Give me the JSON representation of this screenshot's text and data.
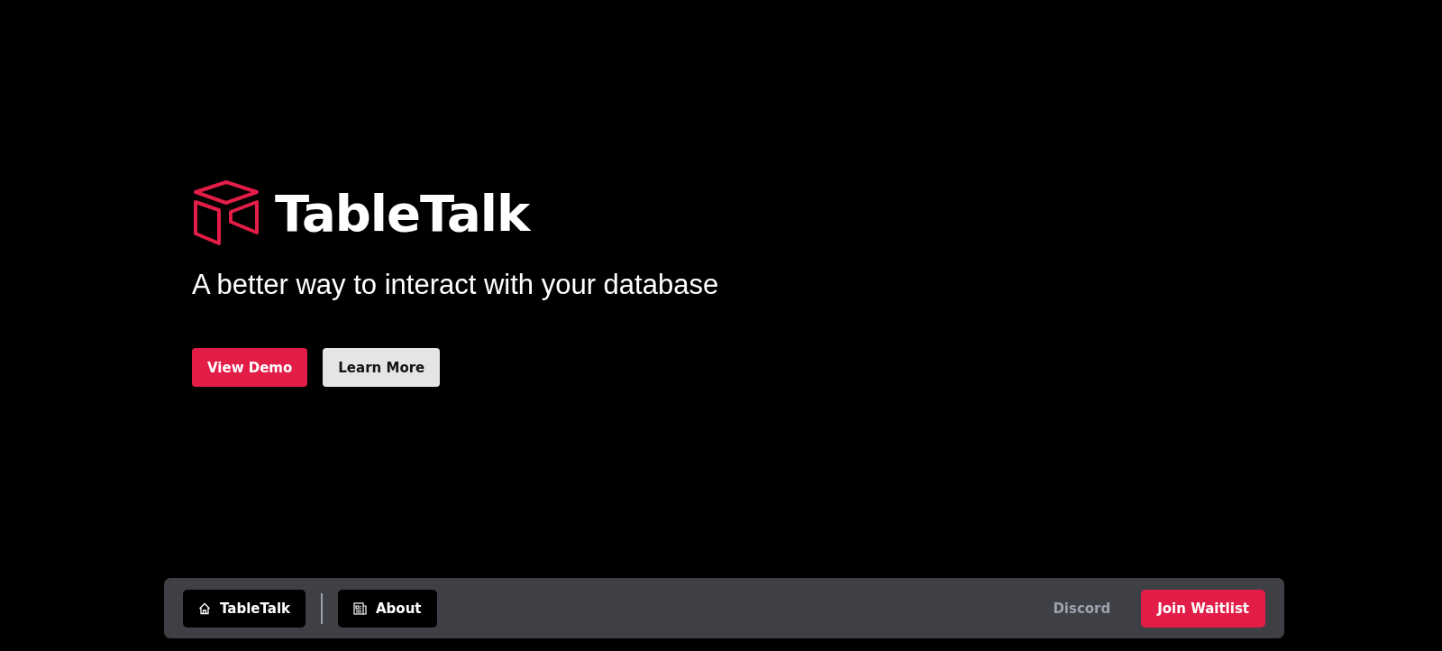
{
  "hero": {
    "title": "TableTalk",
    "tagline": "A better way to interact with your database",
    "buttons": [
      {
        "label": "View Demo",
        "kind": "primary"
      },
      {
        "label": "Learn More",
        "kind": "secondary"
      }
    ]
  },
  "navbar": {
    "items": [
      {
        "label": "TableTalk",
        "kind": "home"
      },
      {
        "label": "About",
        "kind": "news"
      }
    ],
    "link": "Discord",
    "cta": "Join Waitlist"
  }
}
